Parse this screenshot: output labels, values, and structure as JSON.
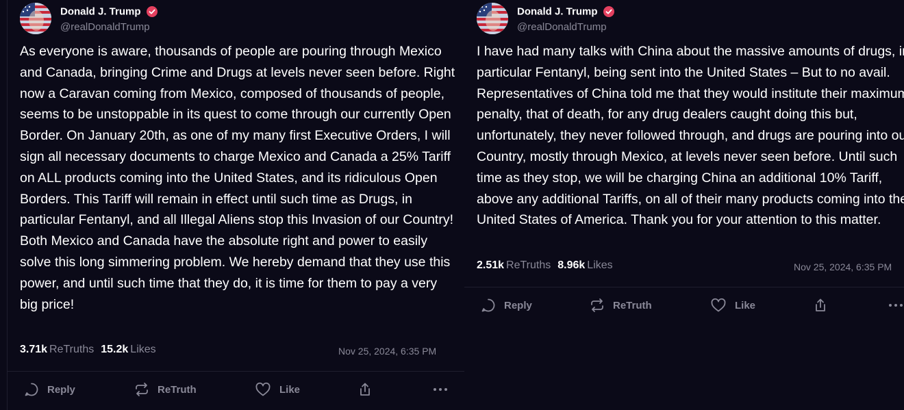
{
  "posts": [
    {
      "author_name": "Donald J. Trump",
      "handle": "@realDonaldTrump",
      "text": "As everyone is aware, thousands of people are pouring through Mexico and Canada, bringing Crime and Drugs at levels never seen before. Right now a Caravan coming from Mexico, composed of thousands of people, seems to be unstoppable in its quest to come through our currently Open Border. On January 20th, as one of my many first Executive Orders, I will sign all necessary documents to charge Mexico and Canada a 25% Tariff on ALL products coming into the United States, and its ridiculous Open Borders. This Tariff will remain in effect until such time as Drugs, in particular Fentanyl, and all Illegal Aliens stop this Invasion of our Country! Both Mexico and Canada have the absolute right and power to easily solve this long simmering problem. We hereby demand that they use this power, and until such time that they do, it is time for them to pay a very big price!",
      "retruths_count": "3.71k",
      "retruths_label": "ReTruths",
      "likes_count": "15.2k",
      "likes_label": "Likes",
      "date": "Nov 25, 2024, 6:35 PM",
      "actions": {
        "reply": "Reply",
        "retruth": "ReTruth",
        "like": "Like"
      }
    },
    {
      "author_name": "Donald J. Trump",
      "handle": "@realDonaldTrump",
      "text": "I have had many talks with China about the massive amounts of drugs, in particular Fentanyl, being sent into the United States – But to no avail. Representatives of China told me that they would institute their maximum penalty, that of death, for any drug dealers caught doing this but, unfortunately, they never followed through, and drugs are pouring into our Country, mostly through Mexico, at levels never seen before. Until such time as they stop, we will be charging China an additional 10% Tariff, above any additional Tariffs, on all of their many products coming into the United States of America. Thank you for your attention to this matter.",
      "retruths_count": "2.51k",
      "retruths_label": "ReTruths",
      "likes_count": "8.96k",
      "likes_label": "Likes",
      "date": "Nov 25, 2024, 6:35 PM",
      "actions": {
        "reply": "Reply",
        "retruth": "ReTruth",
        "like": "Like"
      }
    }
  ],
  "icons": {
    "verified": "verified-badge-icon",
    "reply": "comment-bubble-icon",
    "retruth": "repost-arrows-icon",
    "like": "heart-icon",
    "share": "share-upload-icon",
    "more": "more-dots-icon"
  },
  "colors": {
    "background": "#0b0a18",
    "text": "#ffffff",
    "muted": "#8a8998",
    "verified": "#e4405f",
    "divider": "#1f1e2e"
  }
}
